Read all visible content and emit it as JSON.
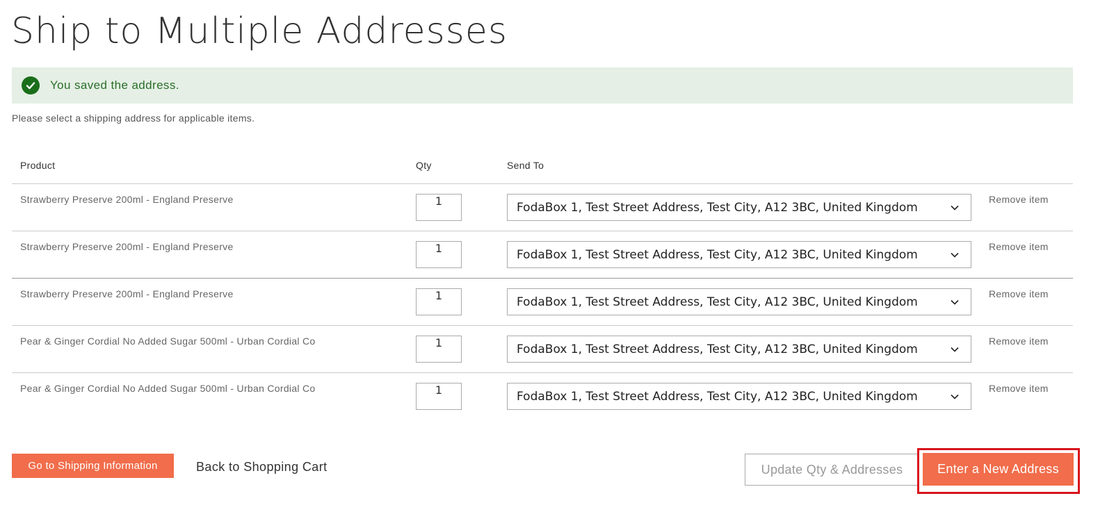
{
  "page": {
    "title": "Ship to Multiple Addresses"
  },
  "message": {
    "text": "You saved the address.",
    "icon": "check-circle-icon",
    "color": "#1a6e1a"
  },
  "instructions": "Please select a shipping address for applicable items.",
  "table": {
    "headers": {
      "product": "Product",
      "qty": "Qty",
      "send_to": "Send To"
    },
    "rows": [
      {
        "product": "Strawberry Preserve 200ml - England Preserve",
        "qty": "1",
        "address": "FodaBox 1, Test Street Address, Test City, A12 3BC, United Kingdom",
        "remove": "Remove item"
      },
      {
        "product": "Strawberry Preserve 200ml - England Preserve",
        "qty": "1",
        "address": "FodaBox 1, Test Street Address, Test City, A12 3BC, United Kingdom",
        "remove": "Remove item"
      },
      {
        "product": "Strawberry Preserve 200ml - England Preserve",
        "qty": "1",
        "address": "FodaBox 1, Test Street Address, Test City, A12 3BC, United Kingdom",
        "remove": "Remove item"
      },
      {
        "product": "Pear & Ginger Cordial No Added Sugar 500ml - Urban Cordial Co",
        "qty": "1",
        "address": "FodaBox 1, Test Street Address, Test City, A12 3BC, United Kingdom",
        "remove": "Remove item"
      },
      {
        "product": "Pear & Ginger Cordial No Added Sugar 500ml - Urban Cordial Co",
        "qty": "1",
        "address": "FodaBox 1, Test Street Address, Test City, A12 3BC, United Kingdom",
        "remove": "Remove item"
      }
    ]
  },
  "actions": {
    "go_shipping": "Go to Shipping Information",
    "back_cart": "Back to Shopping Cart",
    "update": "Update Qty & Addresses",
    "new_address": "Enter a New Address"
  },
  "colors": {
    "primary": "#f16d4b",
    "highlight": "#d8141c",
    "success_bg": "#e5efe5"
  }
}
